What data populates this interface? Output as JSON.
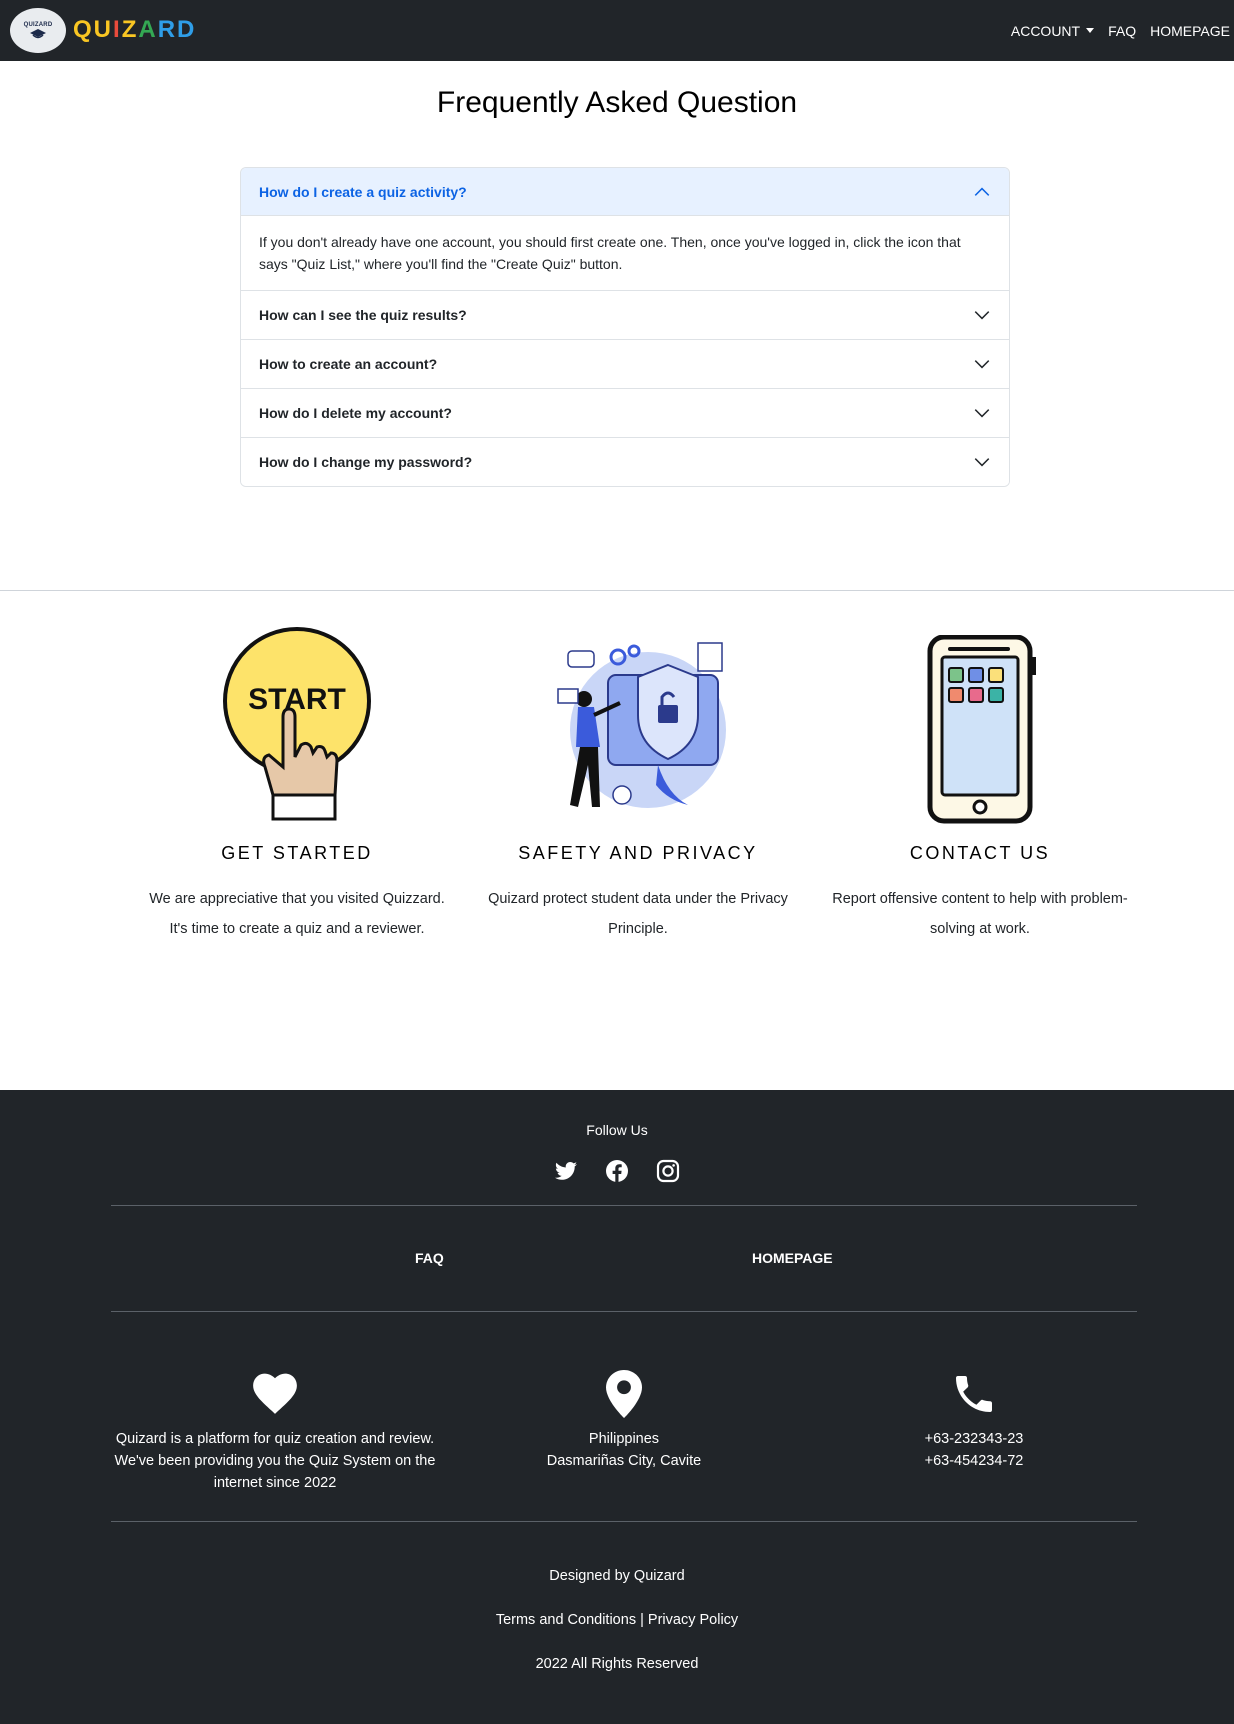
{
  "navbar": {
    "brand_letters": [
      "Q",
      "U",
      "I",
      "Z",
      "A",
      "R",
      "D"
    ],
    "brand_colors": [
      "#f9c623",
      "#f9c623",
      "#e94b3c",
      "#f9c623",
      "#34a853",
      "#2f9ee8",
      "#2f9ee8"
    ],
    "logo_text": "QUIZARD",
    "account_label": "ACCOUNT",
    "faq_label": "FAQ",
    "homepage_label": "HOMEPAGE"
  },
  "faq": {
    "title": "Frequently Asked Question",
    "items": [
      {
        "question": "How do I create a quiz activity?",
        "answer": "If you don't already have one account, you should first create one. Then, once you've logged in, click the icon that says \"Quiz List,\" where you'll find the \"Create Quiz\" button.",
        "open": true
      },
      {
        "question": "How can I see the quiz results?",
        "open": false
      },
      {
        "question": "How to create an account?",
        "open": false
      },
      {
        "question": "How do I delete my account?",
        "open": false
      },
      {
        "question": "How do I change my password?",
        "open": false
      }
    ]
  },
  "features": [
    {
      "title": "GET STARTED",
      "text": "We are appreciative that you visited Quizzard. It's time to create a quiz and a reviewer.",
      "art_label": "START",
      "icon": "start-button-icon"
    },
    {
      "title": "SAFETY AND PRIVACY",
      "text": "Quizard protect student data under the Privacy Principle.",
      "icon": "security-illustration"
    },
    {
      "title": "CONTACT US",
      "text": "Report offensive content to help with problem-solving at work.",
      "icon": "smartphone-icon"
    }
  ],
  "footer": {
    "follow_label": "Follow Us",
    "social_icons": [
      "twitter-icon",
      "facebook-icon",
      "instagram-icon"
    ],
    "faq_label": "FAQ",
    "homepage_label": "HOMEPAGE",
    "about": {
      "icon": "heart-icon",
      "line1": "Quizard is a platform for quiz creation and review.",
      "line2": "We've been providing you the Quiz System on the",
      "line3": "internet since 2022"
    },
    "location": {
      "icon": "location-pin-icon",
      "line1": "Philippines",
      "line2": "Dasmariñas City, Cavite"
    },
    "phone": {
      "icon": "phone-icon",
      "line1": "+63-232343-23",
      "line2": "+63-454234-72"
    },
    "designed_by": "Designed by Quizard",
    "terms_label": "Terms and Conditions",
    "separator": "|",
    "privacy_label": "Privacy Policy",
    "rights": "2022 All Rights Reserved"
  }
}
